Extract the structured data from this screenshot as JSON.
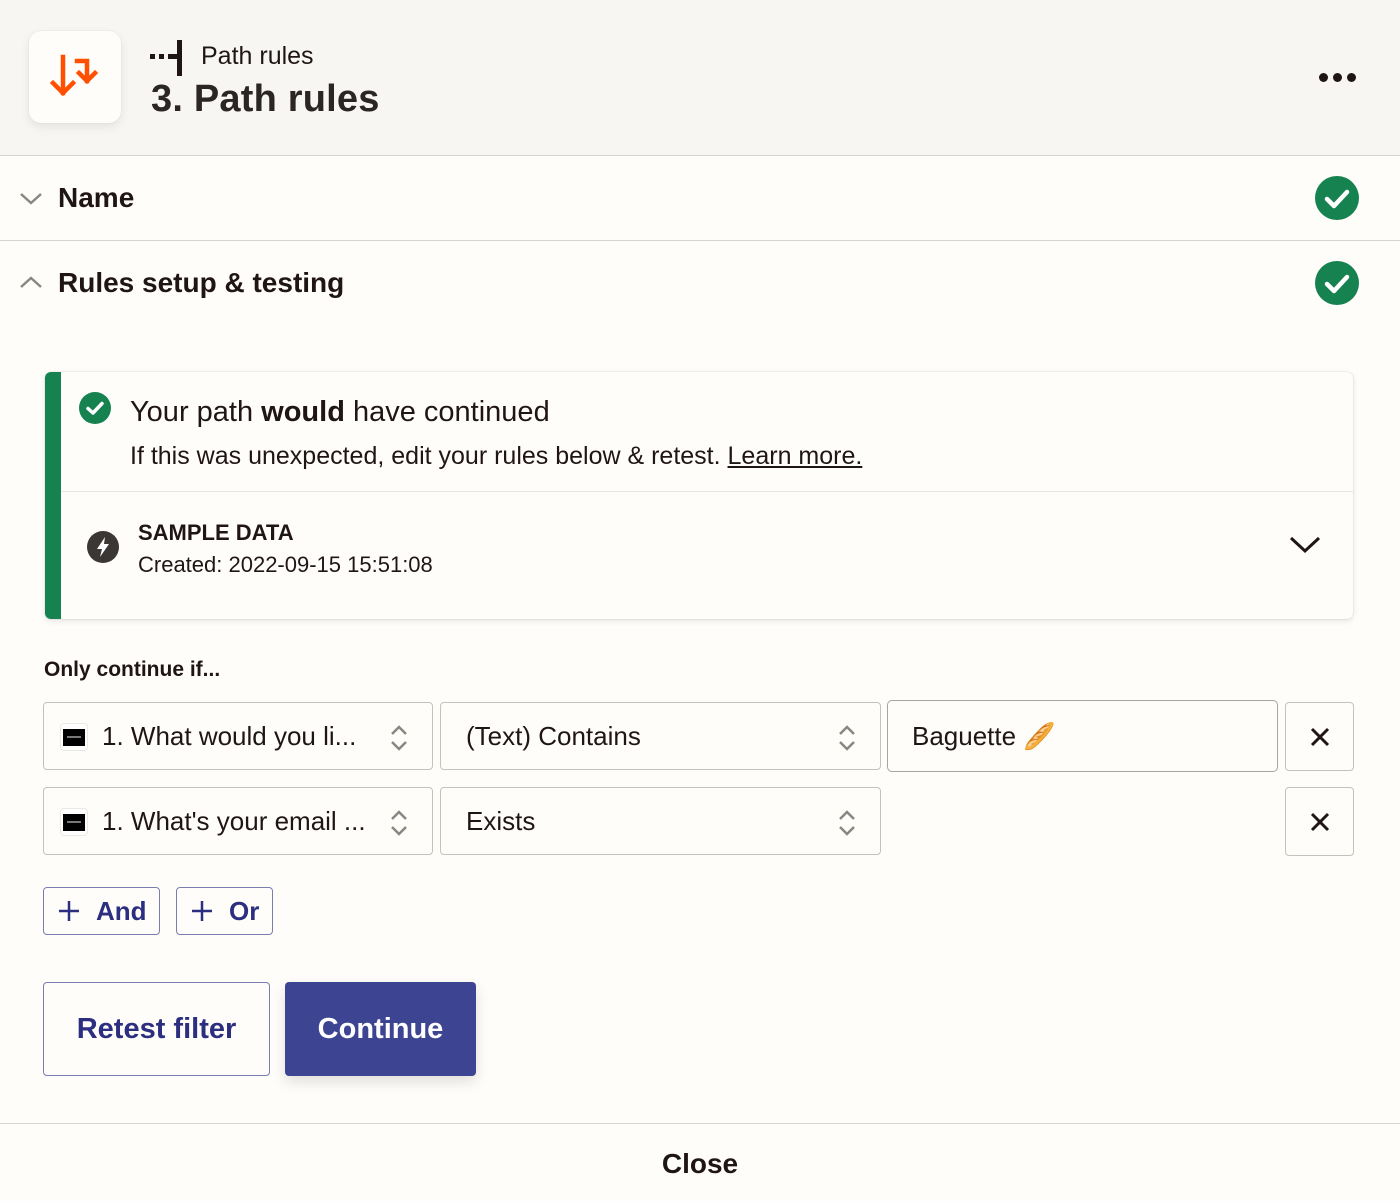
{
  "header": {
    "app_icon": "path-rules-arrows-icon",
    "step_type_icon": "path-branch-icon",
    "subtitle": "Path rules",
    "title": "3. Path rules",
    "more_menu_icon": "more-horizontal-icon",
    "brand_color": "#ff4f00"
  },
  "sections": [
    {
      "label": "Name",
      "state": "collapsed",
      "status": "complete",
      "chevron_icon": "chevron-down-icon",
      "status_icon": "check-circle-icon"
    },
    {
      "label": "Rules setup & testing",
      "state": "expanded",
      "status": "complete",
      "chevron_icon": "chevron-up-icon",
      "status_icon": "check-circle-icon"
    }
  ],
  "result": {
    "title_prefix": "Your path ",
    "title_bold": "would",
    "title_suffix": " have continued",
    "subtitle": "If this was unexpected, edit your rules below & retest. ",
    "learn_more": "Learn more.",
    "status_color": "#168250",
    "sample": {
      "icon": "lightning-bolt-icon",
      "title": "SAMPLE DATA",
      "created": "Created: 2022-09-15 15:51:08",
      "expand_icon": "chevron-down-icon"
    }
  },
  "rules": {
    "label": "Only continue if...",
    "conditions": [
      {
        "field_app_icon": "typeform-logo",
        "field": "1. What would you li...",
        "operator": "(Text) Contains",
        "value": "Baguette 🥖",
        "remove_icon": "close-icon"
      },
      {
        "field_app_icon": "typeform-logo",
        "field": "1. What's your email ...",
        "operator": "Exists",
        "value": null,
        "remove_icon": "close-icon"
      }
    ],
    "add_and": "And",
    "add_or": "Or"
  },
  "actions": {
    "retest": "Retest filter",
    "continue": "Continue",
    "primary_color": "#3d4592"
  },
  "footer": {
    "close": "Close"
  }
}
